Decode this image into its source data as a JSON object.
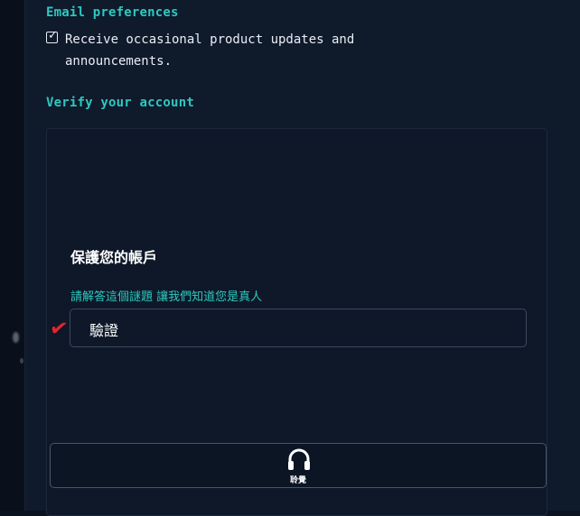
{
  "email_prefs": {
    "title": "Email preferences",
    "checkbox_line1": "Receive occasional product updates and",
    "checkbox_line2": "announcements.",
    "checked": true
  },
  "verify": {
    "title": "Verify your account",
    "captcha_title": "保護您的帳戶",
    "captcha_hint": "請解答這個謎題 讓我們知道您是真人",
    "verify_button": "驗證",
    "audio_button": "聆覺"
  },
  "colors": {
    "accent": "#2fc8c0",
    "background": "#0f1a2b",
    "check_mark": "#e0242c"
  },
  "icons": {
    "checkbox": "checkmark-icon",
    "verified": "red-checkmark-icon",
    "audio": "headphones-icon"
  }
}
